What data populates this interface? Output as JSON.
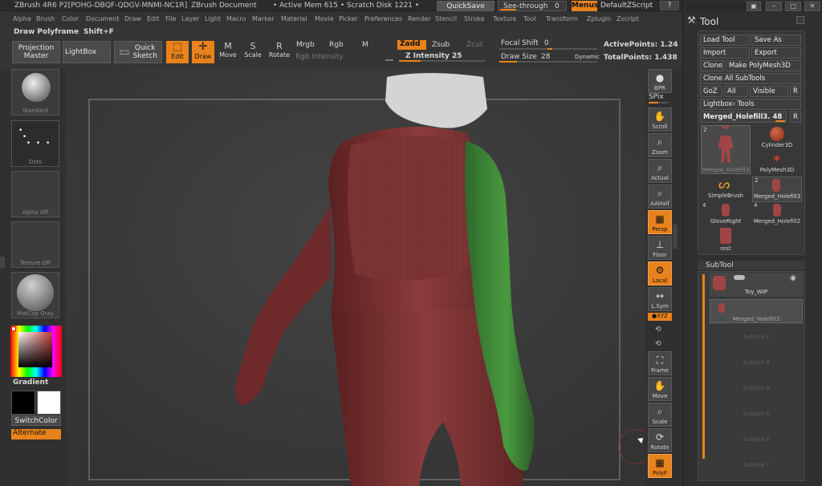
{
  "titlebar": {
    "app": "ZBrush 4R6 P2[POHG-DBQF-QDGV-MNMI-NC1R]",
    "doc": "ZBrush Document",
    "mem": "• Active Mem 615 • Scratch Disk 1221 •",
    "quicksave": "QuickSave",
    "seethrough": "See-through",
    "seethrough_val": "0",
    "menus": "Menus",
    "script": "DefaultZScript"
  },
  "menu": [
    "Alpha",
    "Brush",
    "Color",
    "Document",
    "Draw",
    "Edit",
    "File",
    "Layer",
    "Light",
    "Macro",
    "Marker",
    "Material",
    "Movie",
    "Picker",
    "Preferences",
    "Render",
    "Stencil",
    "Stroke",
    "Texture",
    "Tool",
    "Transform",
    "Zplugin",
    "Zscript"
  ],
  "shelf": {
    "polyframe": "Draw Polyframe",
    "polyframe_key": "Shift+F",
    "projection": "Projection Master",
    "lightbox": "LightBox",
    "quicksketch": "Quick Sketch",
    "edit": "Edit",
    "draw": "Draw",
    "move": "Move",
    "scale": "Scale",
    "rotate": "Rotate",
    "mrgb": "Mrgb",
    "rgb": "Rgb",
    "m": "M",
    "rgb_intensity": "Rgb Intensity",
    "zadd": "Zadd",
    "zsub": "Zsub",
    "zcut": "Zcut",
    "z_intensity": "Z Intensity 25",
    "focal_shift": "Focal Shift",
    "focal_val": "0",
    "draw_size": "Draw Size",
    "draw_size_val": "28",
    "dynamic": "Dynamic",
    "active_points": "ActivePoints: 1.24",
    "total_points": "TotalPoints: 1.438"
  },
  "lefttray": {
    "brush": "Standard",
    "stroke": "Dots",
    "alpha": "Alpha Off",
    "texture": "Texture Off",
    "material": "MatCap Gray",
    "gradient": "Gradient",
    "switchcolor": "SwitchColor",
    "alternate": "Alternate"
  },
  "rightshelf": {
    "bpr": "BPR",
    "spix": "SPix",
    "scroll": "Scroll",
    "zoom": "Zoom",
    "actual": "Actual",
    "aahalf": "AAHalf",
    "persp": "Persp",
    "floor": "Floor",
    "local": "Local",
    "lsym": "L.Sym",
    "xyz": "●XYZ",
    "frame": "Frame",
    "move": "Move",
    "scale": "Scale",
    "rotate": "Rotate",
    "polyf": "PolyF"
  },
  "palette": {
    "title": "Tool",
    "load": "Load Tool",
    "saveas": "Save As",
    "import": "Import",
    "export": "Export",
    "clone": "Clone",
    "make_polymesh": "Make PolyMesh3D",
    "clone_all": "Clone All SubTools",
    "goz": "GoZ",
    "all": "All",
    "visible": "Visible",
    "r": "R",
    "lightbox_tools": "Lightbox› Tools",
    "current_tool": "Merged_Holefill3. 48",
    "tiles": [
      {
        "name": "Merged_Holefill3",
        "count": "2"
      },
      {
        "name": "Cylinder3D",
        "count": ""
      },
      {
        "name": "PolyMesh3D",
        "count": ""
      },
      {
        "name": "SimpleBrush",
        "count": ""
      },
      {
        "name": "Merged_Holefill3",
        "count": "2"
      },
      {
        "name": "GloveRight",
        "count": "4"
      },
      {
        "name": "Merged_Holefill2",
        "count": "4"
      },
      {
        "name": "rest",
        "count": ""
      }
    ],
    "subtool": "SubTool",
    "subtools": [
      "Toy_WIP",
      "Merged_Holefill3"
    ],
    "slots": [
      "Subtool 2",
      "Subtool 3",
      "Subtool 4",
      "Subtool 5",
      "Subtool 6",
      "Subtool 7"
    ]
  }
}
